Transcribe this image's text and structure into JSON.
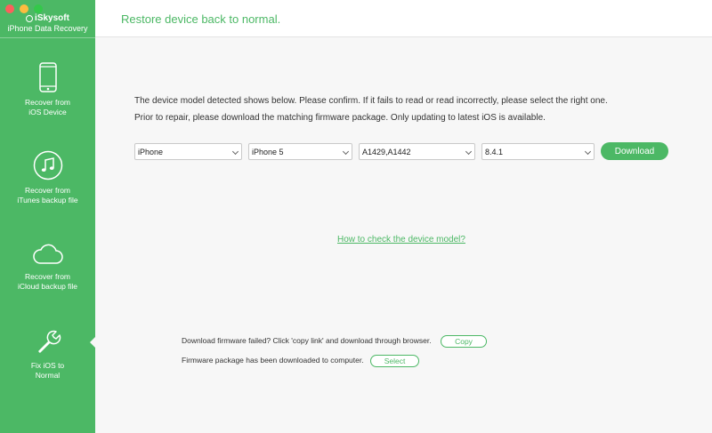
{
  "brand": {
    "name": "iSkysoft",
    "product": "iPhone Data Recovery"
  },
  "sidebar": {
    "items": [
      {
        "icon": "phone-icon",
        "line1": "Recover from",
        "line2": "iOS Device"
      },
      {
        "icon": "music-note-icon",
        "line1": "Recover from",
        "line2": "iTunes backup file"
      },
      {
        "icon": "cloud-icon",
        "line1": "Recover from",
        "line2": "iCloud backup file"
      },
      {
        "icon": "wrench-icon",
        "line1": "Fix iOS to",
        "line2": "Normal",
        "selected": true
      }
    ]
  },
  "header": {
    "title": "Restore device back to normal."
  },
  "main": {
    "instruction1": "The device model detected shows below. Please confirm. If it fails to read or read incorrectly, please select the right one.",
    "instruction2": "Prior to repair, please download the matching firmware package. Only updating to latest iOS is available.",
    "selects": {
      "device": "iPhone",
      "model": "iPhone 5",
      "model_number": "A1429,A1442",
      "ios_version": "8.4.1"
    },
    "download_label": "Download",
    "check_link": "How to check the device model?",
    "failed_text": "Download firmware failed? Click 'copy link' and download through browser.",
    "copy_label": "Copy",
    "downloaded_text": "Firmware package has been downloaded to computer.",
    "select_label": "Select"
  },
  "colors": {
    "accent": "#4cb865",
    "background": "#f7f7f7"
  }
}
